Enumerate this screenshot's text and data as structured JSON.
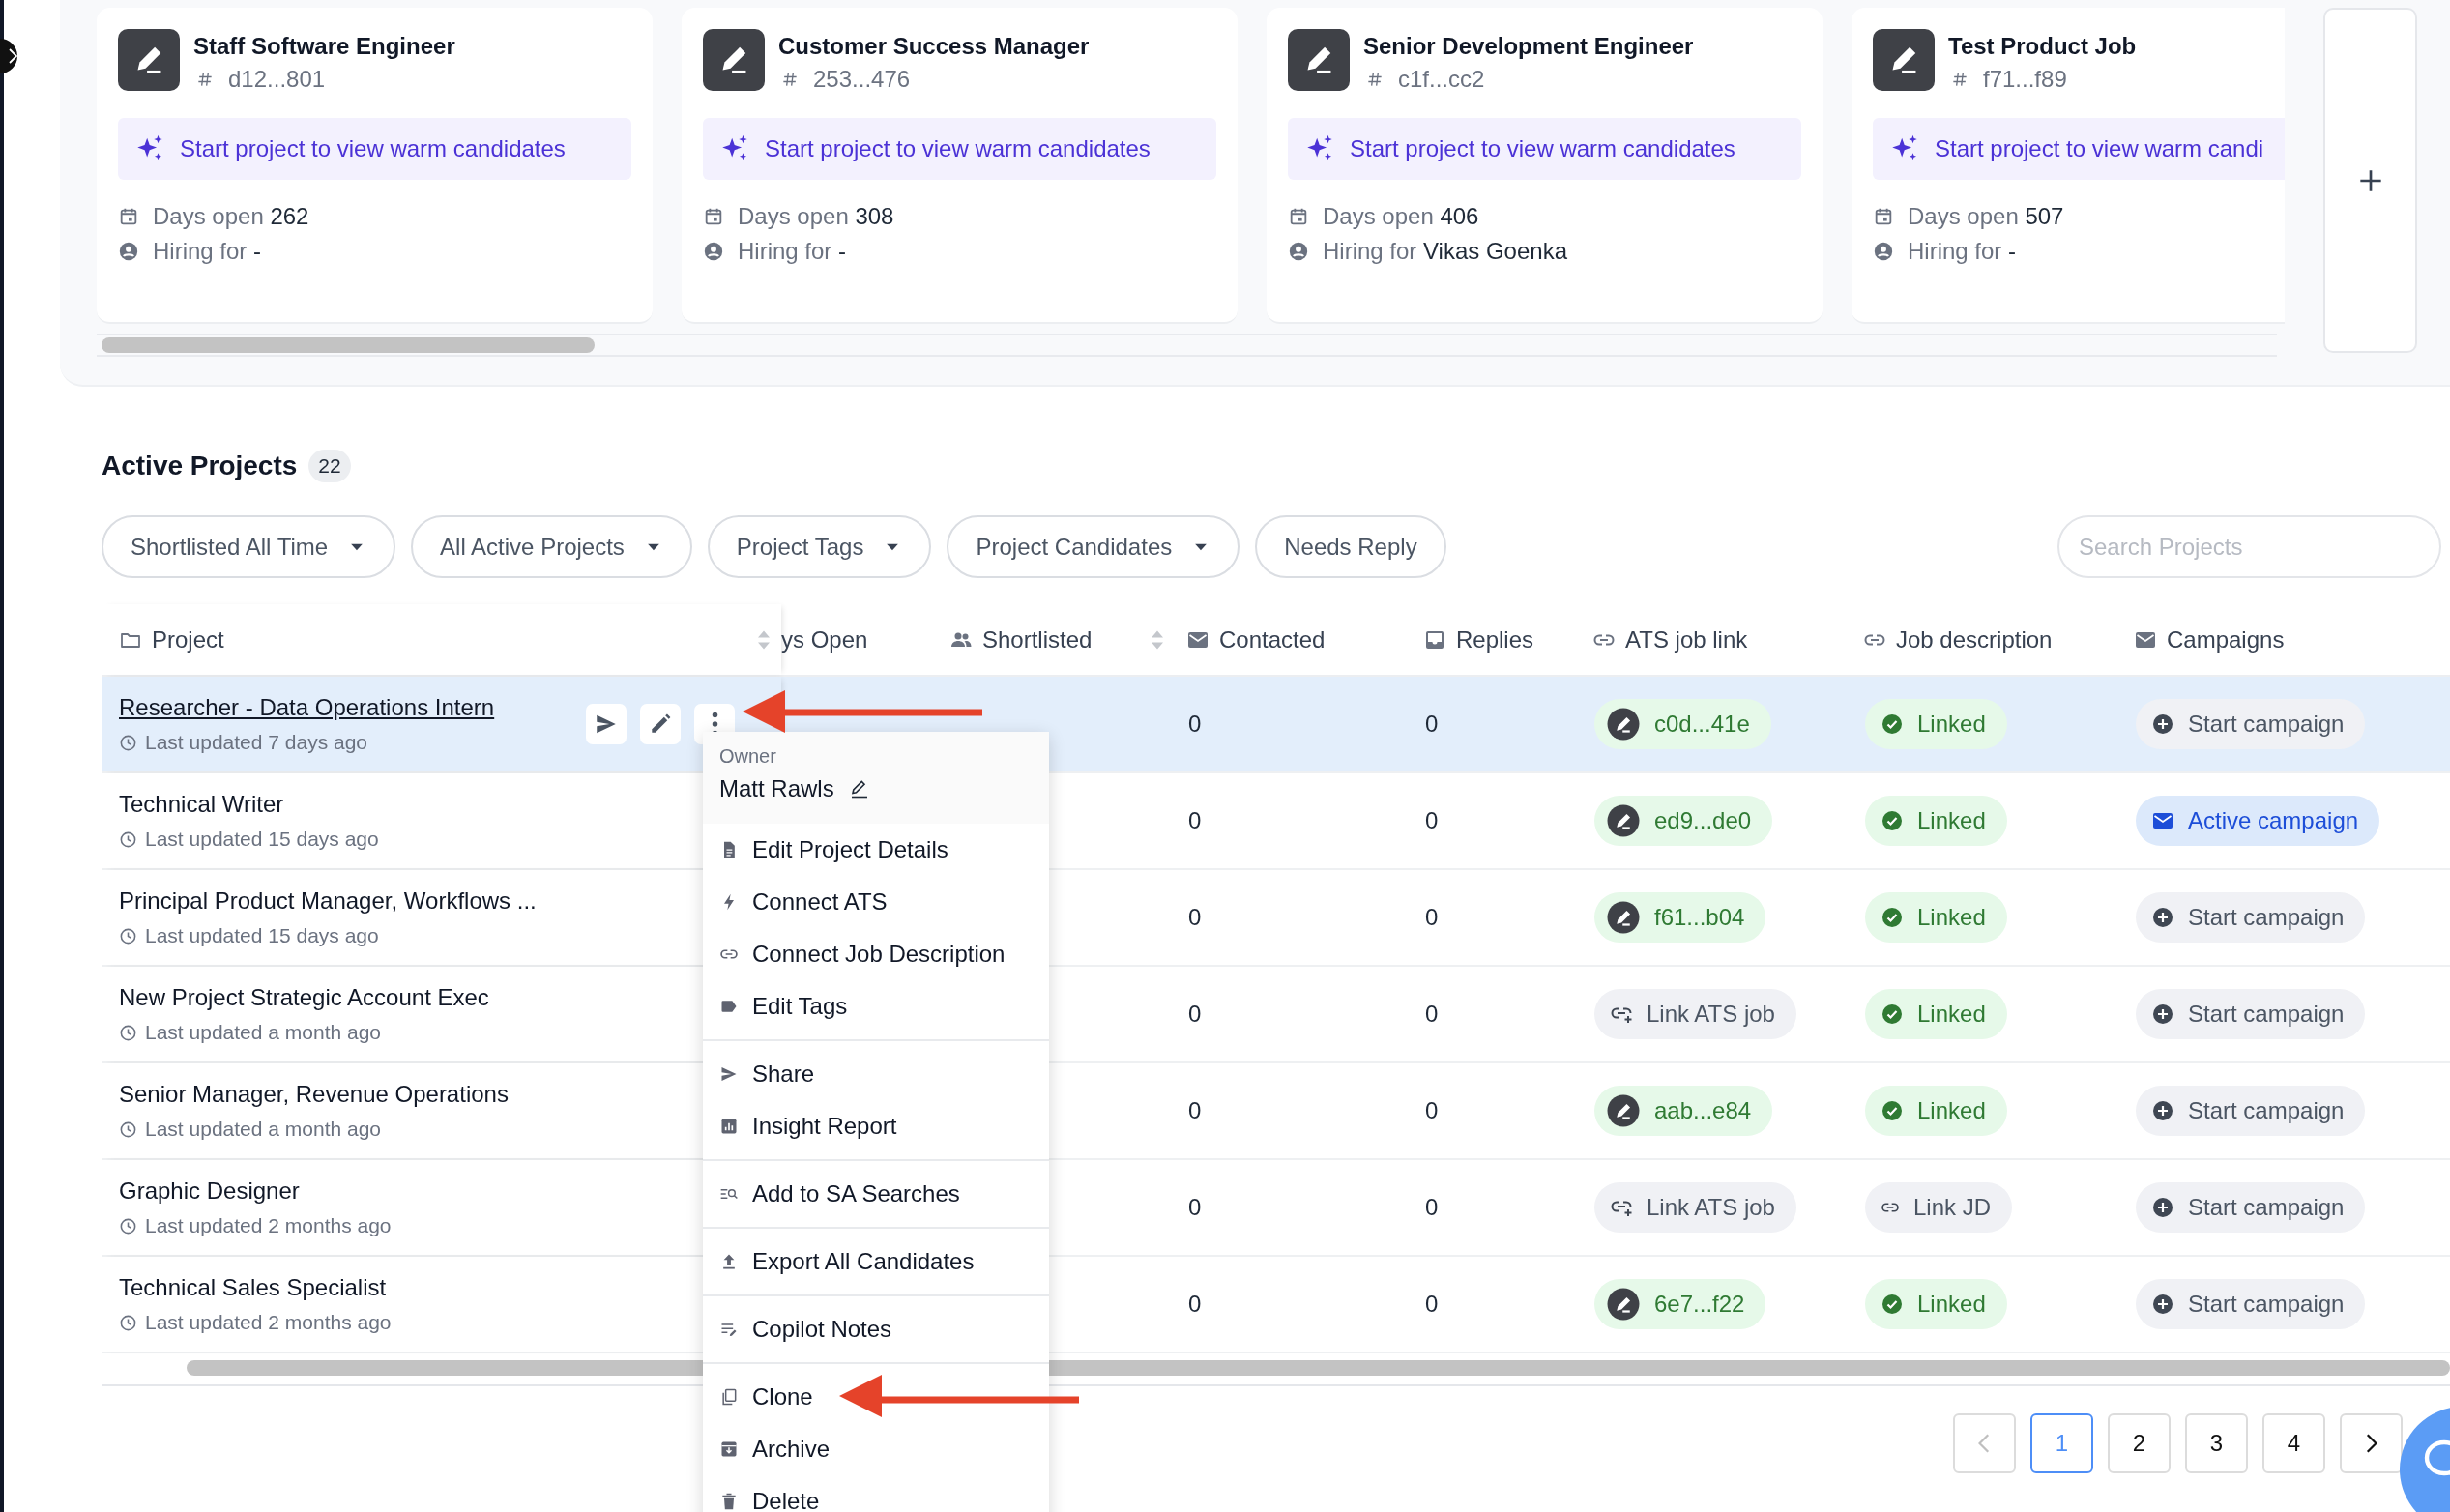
{
  "job_cards": [
    {
      "title": "Staff Software Engineer",
      "id": "d12...801",
      "prompt": "Start project to view warm candidates",
      "days_open_label": "Days open",
      "days_open": "262",
      "hiring_label": "Hiring for",
      "hiring_for": "-"
    },
    {
      "title": "Customer Success Manager",
      "id": "253...476",
      "prompt": "Start project to view warm candidates",
      "days_open_label": "Days open",
      "days_open": "308",
      "hiring_label": "Hiring for",
      "hiring_for": "-"
    },
    {
      "title": "Senior Development Engineer",
      "id": "c1f...cc2",
      "prompt": "Start project to view warm candidates",
      "days_open_label": "Days open",
      "days_open": "406",
      "hiring_label": "Hiring for",
      "hiring_for": "Vikas Goenka"
    },
    {
      "title": "Test Product Job",
      "id": "f71...f89",
      "prompt": "Start project to view warm candi",
      "days_open_label": "Days open",
      "days_open": "507",
      "hiring_label": "Hiring for",
      "hiring_for": "-"
    }
  ],
  "active_projects": {
    "title": "Active Projects",
    "count": "22"
  },
  "filters": [
    {
      "label": "Shortlisted All Time",
      "kind": "dropdown"
    },
    {
      "label": "All Active Projects",
      "kind": "dropdown"
    },
    {
      "label": "Project Tags",
      "kind": "dropdown"
    },
    {
      "label": "Project Candidates",
      "kind": "dropdown"
    },
    {
      "label": "Needs Reply",
      "kind": "toggle"
    }
  ],
  "search": {
    "placeholder": "Search Projects"
  },
  "table": {
    "columns": [
      {
        "label": "Project",
        "sortable": true
      },
      {
        "label": "ys Open",
        "sortable": false
      },
      {
        "label": "Shortlisted",
        "sortable": true
      },
      {
        "label": "Contacted",
        "sortable": false
      },
      {
        "label": "Replies",
        "sortable": false
      },
      {
        "label": "ATS job link",
        "sortable": false
      },
      {
        "label": "Job description",
        "sortable": false
      },
      {
        "label": "Campaigns",
        "sortable": false
      }
    ],
    "rows": [
      {
        "project": "Researcher - Data Operations Intern",
        "updated": "Last updated 7 days ago",
        "selected": true,
        "contacted": "0",
        "replies": "0",
        "ats": {
          "kind": "id",
          "label": "c0d...41e"
        },
        "jd": {
          "kind": "linked",
          "label": "Linked"
        },
        "campaign": {
          "kind": "start",
          "label": "Start campaign"
        }
      },
      {
        "project": "Technical Writer",
        "updated": "Last updated 15 days ago",
        "selected": false,
        "contacted": "0",
        "replies": "0",
        "ats": {
          "kind": "id",
          "label": "ed9...de0"
        },
        "jd": {
          "kind": "linked",
          "label": "Linked"
        },
        "campaign": {
          "kind": "active",
          "label": "Active campaign"
        }
      },
      {
        "project": "Principal Product Manager, Workflows ...",
        "updated": "Last updated 15 days ago",
        "selected": false,
        "contacted": "0",
        "replies": "0",
        "ats": {
          "kind": "id",
          "label": "f61...b04"
        },
        "jd": {
          "kind": "linked",
          "label": "Linked"
        },
        "campaign": {
          "kind": "start",
          "label": "Start campaign"
        }
      },
      {
        "project": "New Project Strategic Account Exec",
        "updated": "Last updated a month ago",
        "selected": false,
        "contacted": "0",
        "replies": "0",
        "ats": {
          "kind": "link",
          "label": "Link ATS job"
        },
        "jd": {
          "kind": "linked",
          "label": "Linked"
        },
        "campaign": {
          "kind": "start",
          "label": "Start campaign"
        }
      },
      {
        "project": "Senior Manager, Revenue Operations",
        "updated": "Last updated a month ago",
        "selected": false,
        "contacted": "0",
        "replies": "0",
        "ats": {
          "kind": "id",
          "label": "aab...e84"
        },
        "jd": {
          "kind": "linked",
          "label": "Linked"
        },
        "campaign": {
          "kind": "start",
          "label": "Start campaign"
        }
      },
      {
        "project": "Graphic Designer",
        "updated": "Last updated 2 months ago",
        "selected": false,
        "contacted": "0",
        "replies": "0",
        "ats": {
          "kind": "link",
          "label": "Link ATS job"
        },
        "jd": {
          "kind": "link",
          "label": "Link JD"
        },
        "campaign": {
          "kind": "start",
          "label": "Start campaign"
        }
      },
      {
        "project": "Technical Sales Specialist",
        "updated": "Last updated 2 months ago",
        "selected": false,
        "contacted": "0",
        "replies": "0",
        "ats": {
          "kind": "id",
          "label": "6e7...f22"
        },
        "jd": {
          "kind": "linked",
          "label": "Linked"
        },
        "campaign": {
          "kind": "start",
          "label": "Start campaign"
        }
      }
    ]
  },
  "context_menu": {
    "owner_label": "Owner",
    "owner": "Matt Rawls",
    "sections": [
      {
        "items": [
          {
            "label": "Edit Project Details"
          },
          {
            "label": "Connect ATS"
          },
          {
            "label": "Connect Job Description"
          },
          {
            "label": "Edit Tags"
          }
        ]
      },
      {
        "items": [
          {
            "label": "Share"
          },
          {
            "label": "Insight Report"
          }
        ]
      },
      {
        "items": [
          {
            "label": "Add to SA Searches"
          }
        ]
      },
      {
        "items": [
          {
            "label": "Export All Candidates"
          }
        ]
      },
      {
        "items": [
          {
            "label": "Copilot Notes"
          }
        ]
      },
      {
        "items": [
          {
            "label": "Clone"
          },
          {
            "label": "Archive"
          },
          {
            "label": "Delete"
          }
        ]
      }
    ]
  },
  "pagination": {
    "prev_disabled": true,
    "pages": [
      {
        "label": "1",
        "selected": true
      },
      {
        "label": "2",
        "selected": false
      },
      {
        "label": "3",
        "selected": false
      },
      {
        "label": "4",
        "selected": false
      }
    ]
  }
}
